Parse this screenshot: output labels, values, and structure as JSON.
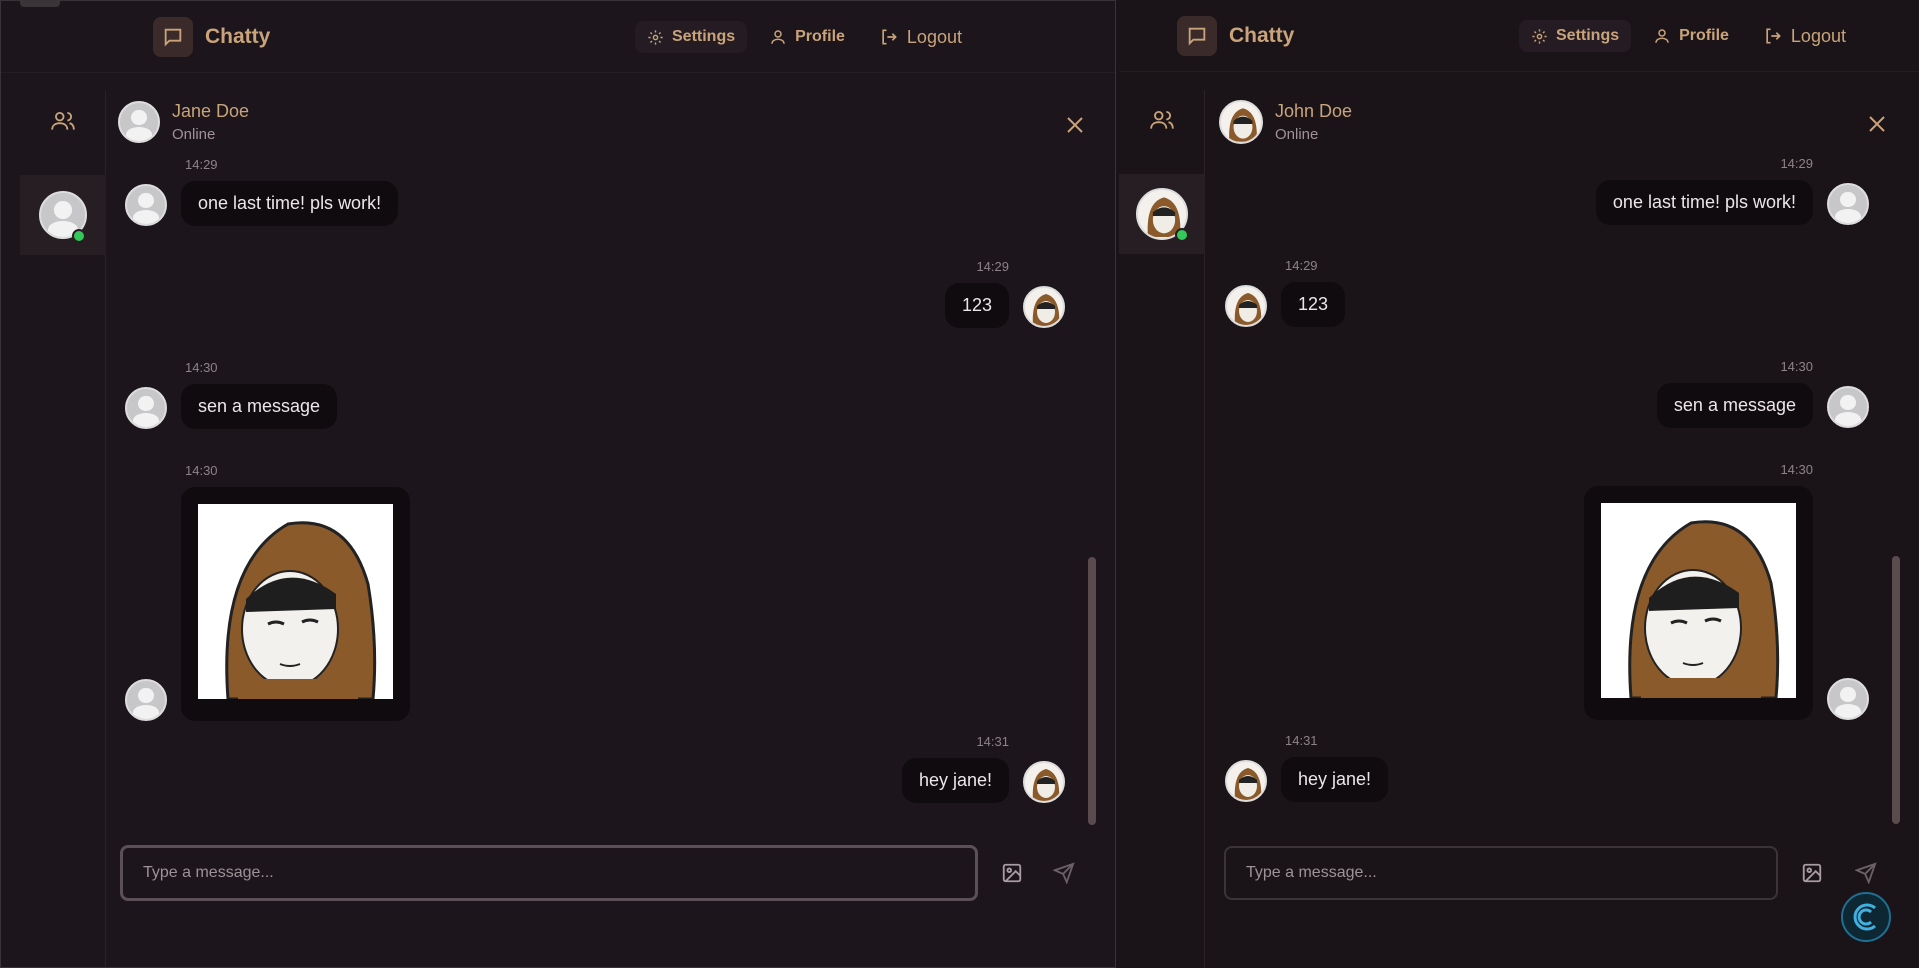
{
  "app": {
    "name": "Chatty"
  },
  "nav": {
    "settings": "Settings",
    "profile": "Profile",
    "logout": "Logout"
  },
  "left": {
    "header": {
      "name": "Jane Doe",
      "status": "Online"
    },
    "messages": [
      {
        "time": "14:29",
        "text": "one last time! pls work!"
      },
      {
        "time": "14:29",
        "text": "123"
      },
      {
        "time": "14:30",
        "text": "sen a message"
      },
      {
        "time": "14:30"
      },
      {
        "time": "14:31",
        "text": "hey jane!"
      }
    ],
    "input_placeholder": "Type a message..."
  },
  "right": {
    "header": {
      "name": "John Doe",
      "status": "Online"
    },
    "messages": [
      {
        "time": "14:29",
        "text": "one last time! pls work!"
      },
      {
        "time": "14:29",
        "text": "123"
      },
      {
        "time": "14:30",
        "text": "sen a message"
      },
      {
        "time": "14:30"
      },
      {
        "time": "14:31",
        "text": "hey jane!"
      }
    ],
    "input_placeholder": "Type a message..."
  },
  "icons": {
    "brand": "chat-bubble-icon",
    "settings": "gear-icon",
    "profile": "user-icon",
    "logout": "logout-icon",
    "contacts": "users-icon",
    "close": "close-icon",
    "image": "image-icon",
    "send": "send-icon"
  },
  "colors": {
    "accent": "#c9a37a",
    "background": "#1c151b",
    "bubble": "#0f0b0e",
    "online": "#34c759"
  }
}
